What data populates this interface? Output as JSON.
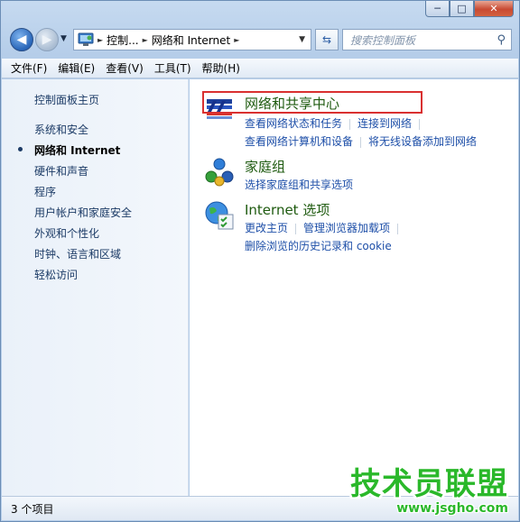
{
  "window": {
    "caption": {
      "minimize": "─",
      "maximize": "□",
      "close": "✕"
    }
  },
  "nav": {
    "back_glyph": "◀",
    "forward_glyph": "▶",
    "address": {
      "segments": [
        "控制...",
        "网络和 Internet"
      ],
      "separator": "►"
    },
    "search_placeholder": "搜索控制面板"
  },
  "menu": [
    "文件(F)",
    "编辑(E)",
    "查看(V)",
    "工具(T)",
    "帮助(H)"
  ],
  "sidebar": {
    "home": "控制面板主页",
    "items": [
      "系统和安全",
      "网络和 Internet",
      "硬件和声音",
      "程序",
      "用户帐户和家庭安全",
      "外观和个性化",
      "时钟、语言和区域",
      "轻松访问"
    ],
    "active_index": 1
  },
  "categories": [
    {
      "title": "网络和共享中心",
      "icon": "network-sharing-center-icon",
      "links": [
        [
          "查看网络状态和任务",
          "连接到网络"
        ],
        [
          "查看网络计算机和设备",
          "将无线设备添加到网络"
        ]
      ],
      "highlighted": true
    },
    {
      "title": "家庭组",
      "icon": "homegroup-icon",
      "links": [
        [
          "选择家庭组和共享选项"
        ]
      ]
    },
    {
      "title": "Internet 选项",
      "icon": "internet-options-icon",
      "links": [
        [
          "更改主页",
          "管理浏览器加载项"
        ],
        [
          "删除浏览的历史记录和 cookie"
        ]
      ]
    }
  ],
  "status": {
    "items": "3 个项目"
  },
  "watermark": {
    "title": "技术员联盟",
    "url": "www.jsgho.com"
  },
  "colors": {
    "highlight": "#d93030",
    "link": "#1e4fa8",
    "category_title": "#1e5a0f",
    "watermark": "#2ab82a"
  }
}
